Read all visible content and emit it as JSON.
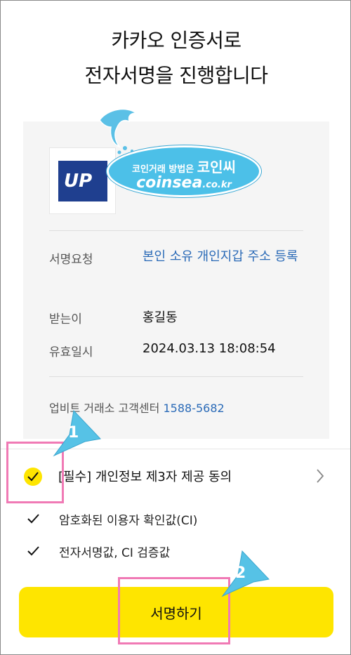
{
  "header": {
    "title_line1": "카카오 인증서로",
    "title_line2": "전자서명을 진행합니다"
  },
  "request": {
    "logo_text": "UP",
    "rows": [
      {
        "label": "서명요청",
        "value": "본인 소유 개인지갑 주소 등록"
      },
      {
        "label": "받는이",
        "value": "홍길동"
      },
      {
        "label": "유효일시",
        "value": "2024.03.13 18:08:54"
      }
    ],
    "service_center": "업비트 거래소 고객센터",
    "service_phone": "1588-5682"
  },
  "watermark": {
    "line1": "코인거래 방법은",
    "brand": "코인씨",
    "domain": "coinsea",
    "domain_suffix": ".co.kr"
  },
  "consent": {
    "main_label": "[필수] 개인정보 제3자 제공 동의",
    "items": [
      {
        "label": "암호화된 이용자 확인값(CI)"
      },
      {
        "label": "전자서명값, CI 검증값"
      }
    ]
  },
  "cta": {
    "label": "서명하기"
  },
  "annotations": {
    "step1": "1",
    "step2": "2"
  },
  "colors": {
    "kakao_yellow": "#fee500",
    "link_blue": "#2a6ab7",
    "highlight_pink": "#f07ab5",
    "callout_blue": "#56c2e6"
  }
}
